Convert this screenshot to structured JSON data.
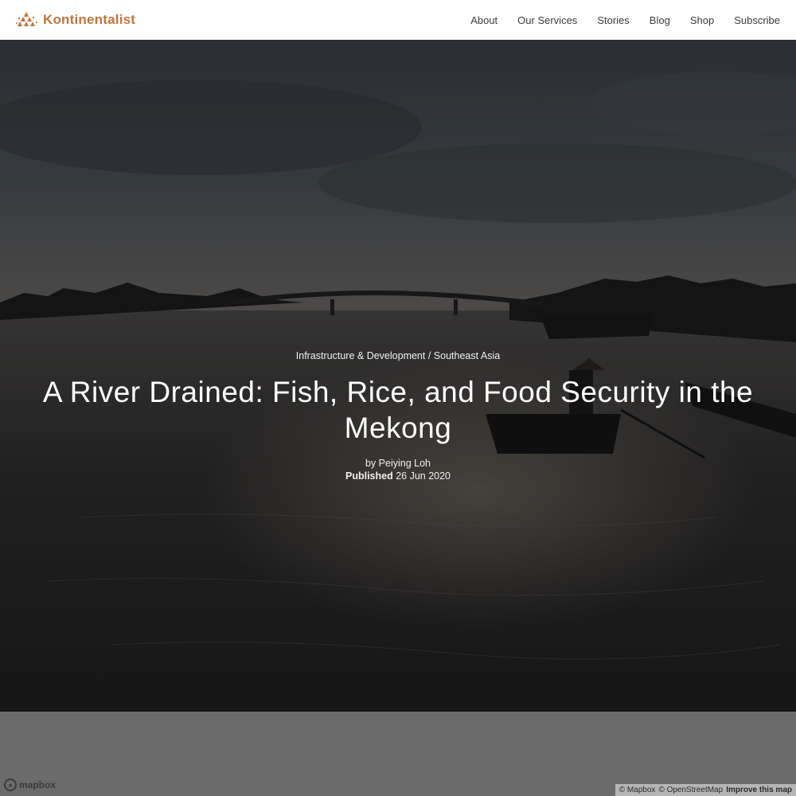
{
  "brand": {
    "name": "Kontinentalist",
    "icon": "kontinentalist-logo-icon",
    "color": "#c2753e"
  },
  "nav": {
    "items": [
      {
        "label": "About"
      },
      {
        "label": "Our Services"
      },
      {
        "label": "Stories"
      },
      {
        "label": "Blog"
      },
      {
        "label": "Shop"
      },
      {
        "label": "Subscribe"
      }
    ]
  },
  "article": {
    "category": "Infrastructure & Development",
    "separator": "/",
    "region": "Southeast Asia",
    "title": "A River Drained: Fish, Rice, and Food Security in the Mekong",
    "byline": "by Peiying Loh",
    "published_label": "Published",
    "published_date": "26 Jun 2020"
  },
  "map": {
    "logo_text": "mapbox",
    "attribution_mapbox": "© Mapbox",
    "attribution_osm": "© OpenStreetMap",
    "improve": "Improve this map"
  }
}
